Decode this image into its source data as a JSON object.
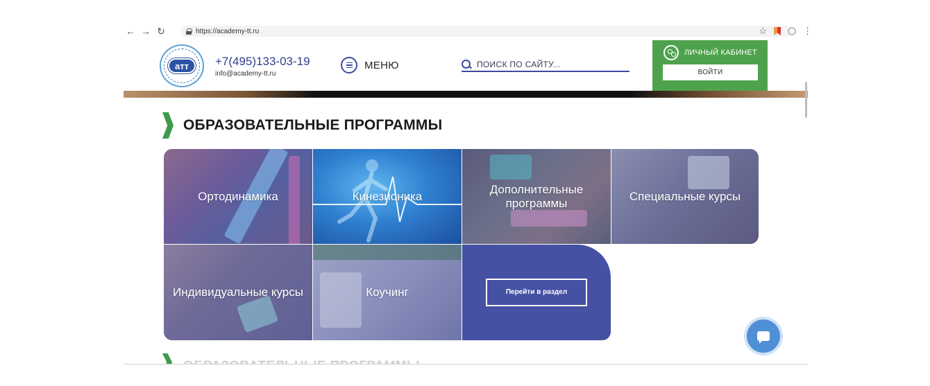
{
  "browser": {
    "top_text": "",
    "url": "https://academy-tt.ru"
  },
  "header": {
    "phone": "+7(495)133-03-19",
    "email": "info@academy-tt.ru",
    "menu_label": "МЕНЮ",
    "search_placeholder": "ПОИСК ПО САЙТУ...",
    "cabinet_label": "ЛИЧНЫЙ КАБИНЕТ",
    "login_label": "ВОЙТИ",
    "logo_text": "атт"
  },
  "section": {
    "title": "ОБРАЗОВАТЕЛЬНЫЕ ПРОГРАММЫ",
    "tiles": [
      {
        "label": "Ортодинамика"
      },
      {
        "label": "Кинезионика"
      },
      {
        "label": "Дополнительные программы"
      },
      {
        "label": "Специальные курсы"
      },
      {
        "label": "Индивидуальные курсы"
      },
      {
        "label": "Коучинг"
      }
    ],
    "goto_label": "Перейти в раздел"
  },
  "colors": {
    "accent_green": "#4fa24d",
    "brand_blue": "#3b4aa0",
    "tile_blue": "#4551a3"
  }
}
